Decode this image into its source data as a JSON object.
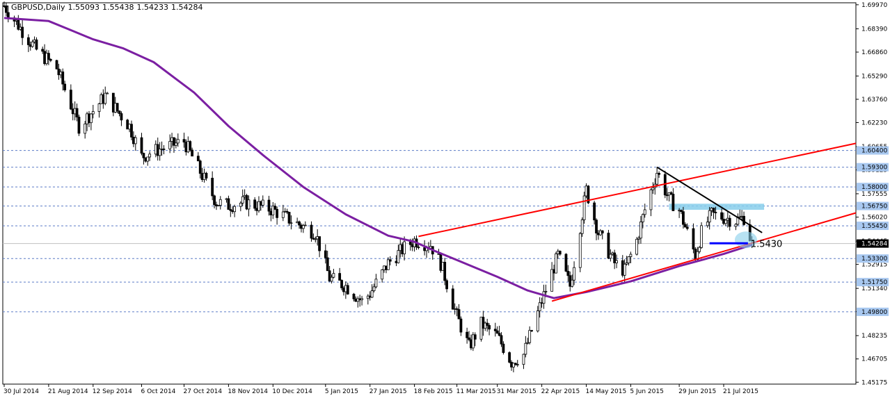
{
  "chart_data": {
    "type": "candlestick",
    "title": "GBPUSD,Daily",
    "ohlc_readout": [
      "1.55093",
      "1.55438",
      "1.54233",
      "1.54284"
    ],
    "ylim": [
      1.4505,
      1.701
    ],
    "y_ticks": [
      "1.69970",
      "1.68390",
      "1.66860",
      "1.65290",
      "1.63760",
      "1.62230",
      "1.60655",
      "1.59125",
      "1.57555",
      "1.56020",
      "1.54445",
      "1.52915",
      "1.51340",
      "1.49810",
      "1.48235",
      "1.46705",
      "1.45175"
    ],
    "x_labels": [
      "30 Jul 2014",
      "21 Aug 2014",
      "12 Sep 2014",
      "6 Oct 2014",
      "27 Oct 2014",
      "18 Nov 2014",
      "10 Dec 2014",
      "5 Jan 2015",
      "27 Jan 2015",
      "18 Feb 2015",
      "11 Mar 2015",
      "31 Mar 2015",
      "22 Apr 2015",
      "14 May 2015",
      "5 Jun 2015",
      "29 Jun 2015",
      "21 Jul 2015"
    ],
    "levels": [
      {
        "price": 1.604,
        "label": "1.60400"
      },
      {
        "price": 1.593,
        "label": "1.59300"
      },
      {
        "price": 1.58,
        "label": "1.58000"
      },
      {
        "price": 1.5675,
        "label": "1.56750"
      },
      {
        "price": 1.5545,
        "label": "1.55450"
      },
      {
        "price": 1.533,
        "label": "1.53300"
      },
      {
        "price": 1.5175,
        "label": "1.51750"
      },
      {
        "price": 1.498,
        "label": "1.49800"
      }
    ],
    "current_price": {
      "price": 1.54284,
      "label": "1.54284"
    },
    "support_line": {
      "price": 1.543,
      "label": "1.5430"
    },
    "anchors": [
      [
        "30 Jul 2014",
        1.699
      ],
      [
        "5 Aug 2014",
        1.688
      ],
      [
        "15 Aug 2014",
        1.67
      ],
      [
        "25 Aug 2014",
        1.658
      ],
      [
        "5 Sep 2014",
        1.62
      ],
      [
        "12 Sep 2014",
        1.63
      ],
      [
        "18 Sep 2014",
        1.64
      ],
      [
        "30 Sep 2014",
        1.62
      ],
      [
        "6 Oct 2014",
        1.6
      ],
      [
        "15 Oct 2014",
        1.605
      ],
      [
        "27 Oct 2014",
        1.61
      ],
      [
        "4 Nov 2014",
        1.59
      ],
      [
        "12 Nov 2014",
        1.57
      ],
      [
        "18 Nov 2014",
        1.568
      ],
      [
        "26 Nov 2014",
        1.57
      ],
      [
        "10 Dec 2014",
        1.565
      ],
      [
        "19 Dec 2014",
        1.558
      ],
      [
        "31 Dec 2014",
        1.55
      ],
      [
        "7 Jan 2015",
        1.52
      ],
      [
        "15 Jan 2015",
        1.515
      ],
      [
        "23 Jan 2015",
        1.505
      ],
      [
        "27 Jan 2015",
        1.51
      ],
      [
        "5 Feb 2015",
        1.53
      ],
      [
        "13 Feb 2015",
        1.54
      ],
      [
        "18 Feb 2015",
        1.545
      ],
      [
        "26 Feb 2015",
        1.542
      ],
      [
        "3 Mar 2015",
        1.53
      ],
      [
        "11 Mar 2015",
        1.495
      ],
      [
        "17 Mar 2015",
        1.475
      ],
      [
        "23 Mar 2015",
        1.49
      ],
      [
        "31 Mar 2015",
        1.482
      ],
      [
        "7 Apr 2015",
        1.465
      ],
      [
        "13 Apr 2015",
        1.47
      ],
      [
        "22 Apr 2015",
        1.505
      ],
      [
        "30 Apr 2015",
        1.535
      ],
      [
        "6 May 2015",
        1.515
      ],
      [
        "14 May 2015",
        1.578
      ],
      [
        "20 May 2015",
        1.55
      ],
      [
        "28 May 2015",
        1.53
      ],
      [
        "2 Jun 2015",
        1.525
      ],
      [
        "8 Jun 2015",
        1.545
      ],
      [
        "12 Jun 2015",
        1.565
      ],
      [
        "18 Jun 2015",
        1.59
      ],
      [
        "24 Jun 2015",
        1.572
      ],
      [
        "29 Jun 2015",
        1.565
      ],
      [
        "7 Jul 2015",
        1.535
      ],
      [
        "10 Jul 2015",
        1.55
      ],
      [
        "15 Jul 2015",
        1.562
      ],
      [
        "21 Jul 2015",
        1.56
      ],
      [
        "27 Jul 2015",
        1.558
      ],
      [
        "31 Jul 2015",
        1.56
      ],
      [
        "4 Aug 2015",
        1.5428
      ]
    ],
    "moving_average": [
      [
        "30 Jul 2014",
        1.691
      ],
      [
        "21 Aug 2014",
        1.689
      ],
      [
        "1 Sep 2014",
        1.683
      ],
      [
        "12 Sep 2014",
        1.677
      ],
      [
        "27 Sep 2014",
        1.671
      ],
      [
        "12 Oct 2014",
        1.662
      ],
      [
        "1 Nov 2014",
        1.642
      ],
      [
        "18 Nov 2014",
        1.62
      ],
      [
        "5 Dec 2014",
        1.601
      ],
      [
        "25 Dec 2014",
        1.58
      ],
      [
        "15 Jan 2015",
        1.562
      ],
      [
        "5 Feb 2015",
        1.548
      ],
      [
        "18 Feb 2015",
        1.544
      ],
      [
        "28 Feb 2015",
        1.538
      ],
      [
        "11 Mar 2015",
        1.532
      ],
      [
        "31 Mar 2015",
        1.521
      ],
      [
        "15 Apr 2015",
        1.512
      ],
      [
        "28 Apr 2015",
        1.507
      ],
      [
        "14 May 2015",
        1.511
      ],
      [
        "5 Jun 2015",
        1.518
      ],
      [
        "29 Jun 2015",
        1.528
      ],
      [
        "10 Jul 2015",
        1.532
      ],
      [
        "21 Jul 2015",
        1.536
      ],
      [
        "4 Aug 2015",
        1.542
      ]
    ],
    "trend_lines": [
      {
        "name": "upper-channel",
        "color": "#ff0000",
        "from": [
          "20 Feb 2015",
          1.5475
        ],
        "to": [
          "31 Jul 2015",
          1.593
        ],
        "extend": true
      },
      {
        "name": "lower-channel",
        "color": "#ff0000",
        "from": [
          "27 Apr 2015",
          1.505
        ],
        "to": [
          "1 Aug 2015",
          1.542
        ],
        "extend": true
      },
      {
        "name": "descending-resistance",
        "color": "#000000",
        "from": [
          "18 Jun 2015",
          1.593
        ],
        "to": [
          "9 Aug 2015",
          1.55
        ],
        "extend": false
      }
    ],
    "zone": {
      "color": "#87ceeb",
      "from": "24 Jun 2015",
      "to": "10 Aug 2015",
      "ymin": 1.565,
      "ymax": 1.569
    },
    "colors": {
      "ma": "#7b1fa2",
      "channel": "#ff0000",
      "resistance": "#000000",
      "support": "#0000ff",
      "grid": "#5b7bc6"
    }
  }
}
